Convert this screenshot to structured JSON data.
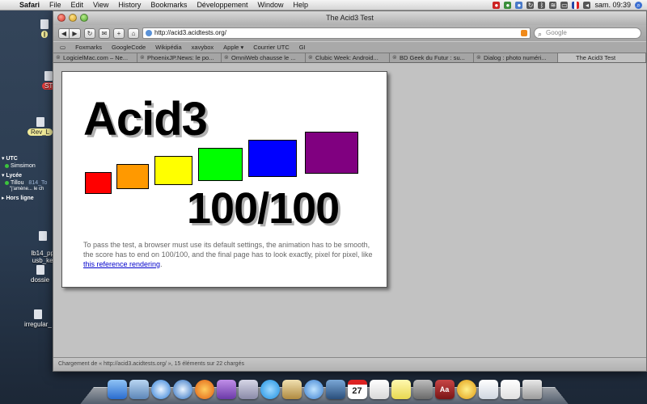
{
  "menubar": {
    "items": [
      "Safari",
      "File",
      "Edit",
      "View",
      "History",
      "Bookmarks",
      "Développement",
      "Window",
      "Help"
    ],
    "clock": "sam. 09:39"
  },
  "desktop": {
    "icons": [
      {
        "label": "l"
      },
      {
        "label": "ST"
      },
      {
        "label": "Rev_L"
      },
      {
        "label": "lb14_pp2\nusb_ke"
      },
      {
        "label": "dossie"
      },
      {
        "label": "irregular_"
      }
    ]
  },
  "buddy": {
    "group_utc": "UTC",
    "utc_buddy": "Simsimon",
    "group_lycee": "Lycée",
    "lycee_buddy": "Tillou",
    "lycee_status": "\"j'amène... le ch",
    "lycee_extra": "814_To",
    "group_offline": "Hors ligne"
  },
  "window": {
    "title": "The Acid3 Test",
    "url": "http://acid3.acidtests.org/",
    "search_placeholder": "Google",
    "bookmarks": [
      "Foxmarks",
      "GoogleCode",
      "Wikipédia",
      "xavybox",
      "Apple ▾",
      "Courrier UTC",
      "GI"
    ],
    "tabs": [
      "LogicielMac.com – Ne...",
      "PhoenixJP.News: le po...",
      "OmniWeb chausse le ...",
      "Clubic Week: Android...",
      "BD Geek du Futur : su...",
      "Dialog : photo numéri...",
      "The Acid3 Test"
    ],
    "status": "Chargement de « http://acid3.acidtests.org/ », 15 éléments sur 22 chargés"
  },
  "acid": {
    "title": "Acid3",
    "score": "100/100",
    "desc_text": "To pass the test, a browser must use its default settings, the animation has to be smooth, the score has to end on 100/100, and the final page has to look exactly, pixel for pixel, like ",
    "link_text": "this reference rendering",
    "desc_end": ".",
    "box_colors": [
      "#ff0000",
      "#ff9900",
      "#ffff00",
      "#00ff00",
      "#0000ff",
      "#800080"
    ]
  },
  "dock": {
    "icons": [
      "finder-icon",
      "mail-icon",
      "safari-icon",
      "safari-alt-icon",
      "firefox-icon",
      "adium-icon",
      "pidgin-icon",
      "skype-icon",
      "flip-icon",
      "itunes-icon",
      "iphoto-icon",
      "ical-icon",
      "textedit-icon",
      "stickies-icon",
      "system-preferences-icon",
      "dictionary-icon",
      "ichat-icon",
      "preview-icon",
      "textfile-icon",
      "trash-icon"
    ],
    "ical_day": "27"
  }
}
